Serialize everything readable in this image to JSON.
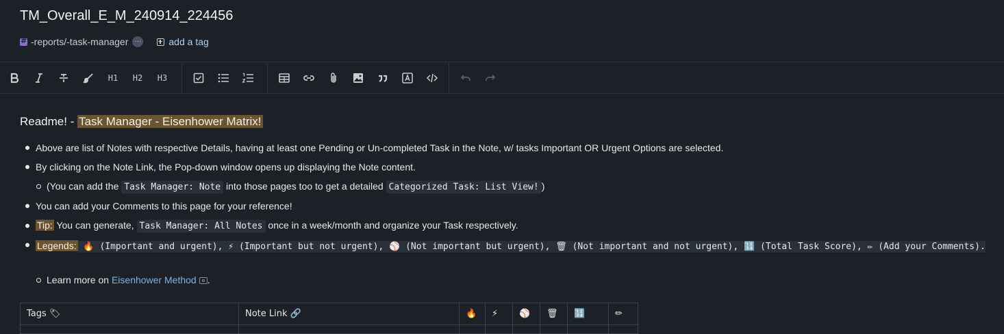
{
  "note": {
    "title": "TM_Overall_E_M_240914_224456",
    "tag": "-reports/-task-manager",
    "more": "···",
    "add_tag": "add a tag"
  },
  "toolbar": {
    "h1": "H1",
    "h2": "H2",
    "h3": "H3",
    "icons": [
      "bold-icon",
      "italic-icon",
      "strikethrough-icon",
      "highlight-brush-icon",
      "heading-1",
      "heading-2",
      "heading-3",
      "checklist-icon",
      "bullet-list-icon",
      "numbered-list-icon",
      "table-icon",
      "link-icon",
      "attachment-icon",
      "image-icon",
      "quote-icon",
      "text-box-icon",
      "code-icon",
      "undo-icon",
      "redo-icon"
    ]
  },
  "content": {
    "readme_prefix": "Readme! - ",
    "readme_highlight": "Task Manager - Eisenhower Matrix!",
    "b1": "Above are list of Notes with respective Details, having at least one Pending or Un-completed Task in the Note, w/ tasks Important OR Urgent Options are selected.",
    "b2": "By clicking on the Note Link, the Pop-down window opens up displaying the Note content.",
    "b2_sub_pre": "(You can add the ",
    "b2_sub_code1": "Task Manager: Note",
    "b2_sub_mid": " into those pages too to get a detailed ",
    "b2_sub_code2": "Categorized Task: List View!",
    "b2_sub_post": ")",
    "b3": "You can add your Comments to this page for your reference!",
    "b4_label": "Tip:",
    "b4_pre": " You can generate, ",
    "b4_code": "Task Manager: All Notes",
    "b4_post": " once in a week/month and organize your Task respectively.",
    "legend_label": "Legends:",
    "legend_text": " 🔥 (Important and urgent), ⚡ (Important but not urgent), ⚾ (Not important but urgent), 🗑 (Not important and not urgent), 🔢 (Total Task Score), ✏ (Add your Comments).",
    "learn_pre": "Learn more on ",
    "learn_link": "Eisenhower Method",
    "learn_post": "."
  },
  "table": {
    "headers": [
      "Tags 🏷",
      "Note Link 🔗",
      "🔥",
      "⚡",
      "⚾",
      "🗑",
      "🔢",
      "✏"
    ]
  },
  "colors": {
    "background": "#1c2128",
    "highlight": "#6b5530",
    "link": "#7ab3e8",
    "tag": "#8d6bd1"
  }
}
